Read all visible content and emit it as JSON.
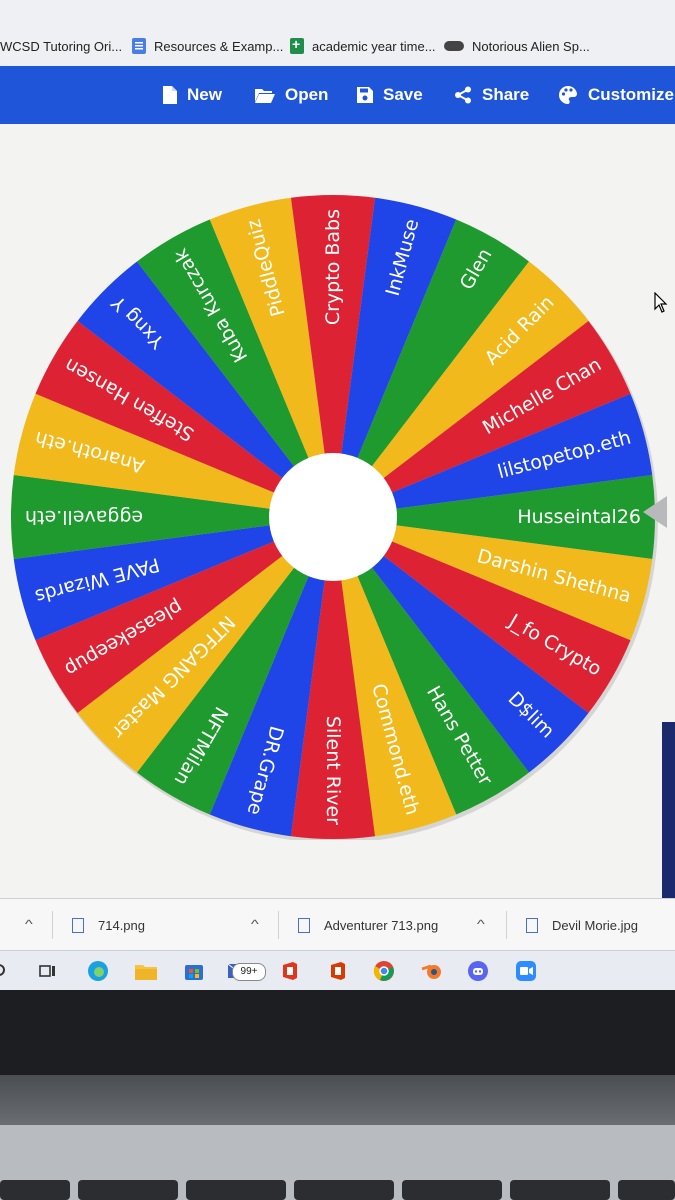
{
  "bookmarks": [
    {
      "label": "WCSD Tutoring Ori...",
      "icon": "page-icon"
    },
    {
      "label": "Resources & Examp...",
      "icon": "google-docs-icon"
    },
    {
      "label": "academic year time...",
      "icon": "google-sheets-icon"
    },
    {
      "label": "Notorious Alien Sp...",
      "icon": "mask-icon"
    }
  ],
  "toolbar": {
    "new_label": "New",
    "open_label": "Open",
    "save_label": "Save",
    "share_label": "Share",
    "customize_label": "Customize"
  },
  "wheel": {
    "entries": [
      "Husseintal26",
      "Darshin Shethna",
      "J_fo Crypto",
      "D$lim",
      "Hans Petter",
      "Commond.eth",
      "Silent River",
      "DR.Grape",
      "NFTMilan",
      "NTFGANG Master",
      "pleasekeepup",
      "PAVE Wizards",
      "eggavell.eth",
      "Anaroth.eth",
      "Steffen Hansen",
      "Yxng Y",
      "Kuba Kurczak",
      "PiddleQuiz",
      "Crypto Babs",
      "InkMuse",
      "Glen",
      "Acid Rain",
      "Michelle Chan",
      "lilstopetop.eth"
    ],
    "colors": [
      "#1e9a2e",
      "#f2b91c",
      "#dd2233",
      "#1f45e8"
    ],
    "text_color": "#ffffff",
    "hub_color": "#ffffff",
    "pointer_color": "#b7b9bb"
  },
  "downloads": [
    {
      "name": "714.png"
    },
    {
      "name": "Adventurer 713.png"
    },
    {
      "name": "Devil Morie.jpg"
    }
  ],
  "taskbar": {
    "badge": "99+",
    "apps": [
      "search-icon",
      "task-view-icon",
      "edge-icon",
      "file-explorer-icon",
      "store-icon",
      "mail-icon",
      "office-icon",
      "office-icon",
      "chrome-icon",
      "blender-icon",
      "discord-icon",
      "zoom-icon"
    ]
  }
}
